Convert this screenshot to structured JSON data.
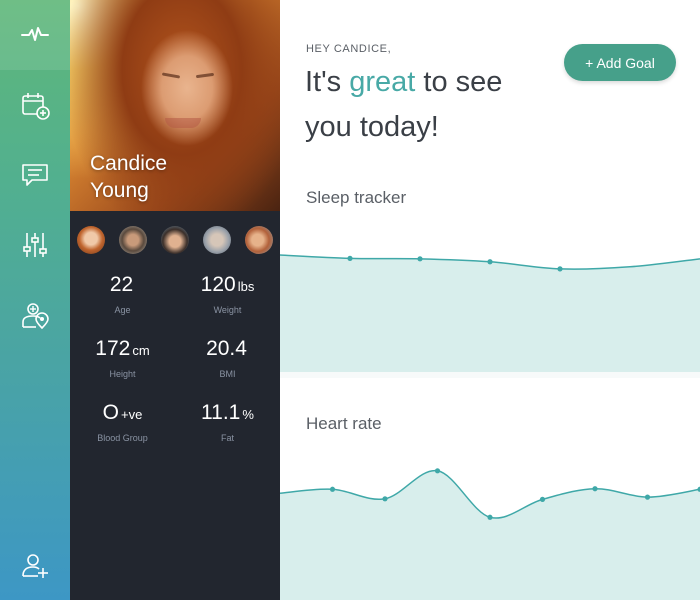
{
  "colors": {
    "accent": "#48a9a6",
    "chart_line": "#3fa8a8",
    "chart_fill": "#d8eeec",
    "button_bg": "#46a08a",
    "profile_bg": "#22262f"
  },
  "sidebar": {
    "items": [
      {
        "icon": "pulse-icon",
        "active": true
      },
      {
        "icon": "calendar-add-icon",
        "active": false
      },
      {
        "icon": "chat-icon",
        "active": false
      },
      {
        "icon": "sliders-icon",
        "active": false
      },
      {
        "icon": "doctor-location-icon",
        "active": false
      }
    ],
    "bottom_icon": "add-user-icon"
  },
  "profile": {
    "first_name": "Candice",
    "last_name": "Young",
    "friends": [
      {
        "icon": "friend-avatar-1"
      },
      {
        "icon": "friend-avatar-2"
      },
      {
        "icon": "friend-avatar-3"
      },
      {
        "icon": "friend-avatar-4"
      },
      {
        "icon": "friend-avatar-5"
      }
    ],
    "stats": [
      {
        "value": "22",
        "unit": "",
        "label": "Age"
      },
      {
        "value": "120",
        "unit": "lbs",
        "label": "Weight"
      },
      {
        "value": "172",
        "unit": "cm",
        "label": "Height"
      },
      {
        "value": "20.4",
        "unit": "",
        "label": "BMI"
      },
      {
        "value": "O",
        "unit": "+ve",
        "label": "Blood Group"
      },
      {
        "value": "11.1",
        "unit": "%",
        "label": "Fat"
      }
    ]
  },
  "main": {
    "greeting": "HEY CANDICE,",
    "headline_pre": "It's ",
    "headline_accent": "great",
    "headline_post": " to see you today!",
    "add_goal_label": "+ Add Goal",
    "sleep_title": "Sleep tracker",
    "heart_title": "Heart rate"
  },
  "chart_data": [
    {
      "type": "area",
      "title": "Sleep tracker",
      "x": [
        0,
        1,
        2,
        3,
        4,
        5,
        6
      ],
      "values": [
        0.38,
        0.3,
        0.29,
        0.22,
        0.05,
        0.1,
        0.29
      ],
      "points_marked": [
        1,
        2,
        3,
        4
      ],
      "ylim": [
        0,
        1
      ]
    },
    {
      "type": "area",
      "title": "Heart rate",
      "x": [
        0,
        1,
        2,
        3,
        4,
        5,
        6,
        7,
        8
      ],
      "values": [
        0.55,
        0.62,
        0.45,
        0.95,
        0.12,
        0.44,
        0.63,
        0.48,
        0.62
      ],
      "points_marked": [
        1,
        2,
        3,
        4,
        5,
        6,
        7,
        8
      ],
      "ylim": [
        0,
        1
      ]
    }
  ]
}
